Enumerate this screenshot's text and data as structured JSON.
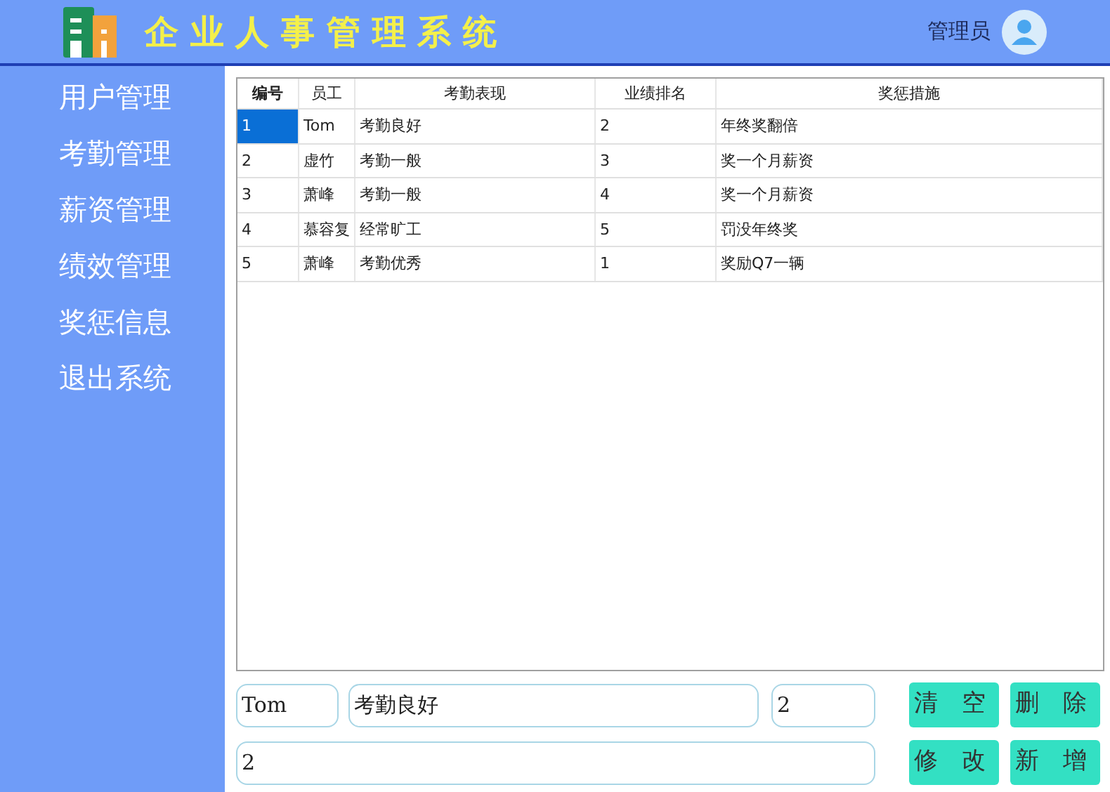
{
  "header": {
    "title": "企 业 人 事 管 理 系 统",
    "user": "管理员"
  },
  "sidebar": {
    "items": [
      {
        "label": "用户管理"
      },
      {
        "label": "考勤管理"
      },
      {
        "label": "薪资管理"
      },
      {
        "label": "绩效管理"
      },
      {
        "label": "奖惩信息"
      },
      {
        "label": "退出系统"
      }
    ]
  },
  "table": {
    "columns": [
      "编号",
      "员工",
      "考勤表现",
      "业绩排名",
      "奖惩措施"
    ],
    "rows": [
      {
        "cells": [
          "1",
          "Tom",
          "考勤良好",
          "2",
          "年终奖翻倍"
        ],
        "selected": true
      },
      {
        "cells": [
          "2",
          "虚竹",
          "考勤一般",
          "3",
          "奖一个月薪资"
        ],
        "selected": false
      },
      {
        "cells": [
          "3",
          "萧峰",
          "考勤一般",
          "4",
          "奖一个月薪资"
        ],
        "selected": false
      },
      {
        "cells": [
          "4",
          "慕容复",
          "经常旷工",
          "5",
          "罚没年终奖"
        ],
        "selected": false
      },
      {
        "cells": [
          "5",
          "萧峰",
          "考勤优秀",
          "1",
          "奖励Q7一辆"
        ],
        "selected": false
      }
    ]
  },
  "form": {
    "fields": [
      {
        "value": "Tom"
      },
      {
        "value": "考勤良好"
      },
      {
        "value": "2"
      },
      {
        "value": "2"
      }
    ],
    "buttons": [
      "清 空",
      "删 除",
      "修 改",
      "新 增"
    ]
  }
}
